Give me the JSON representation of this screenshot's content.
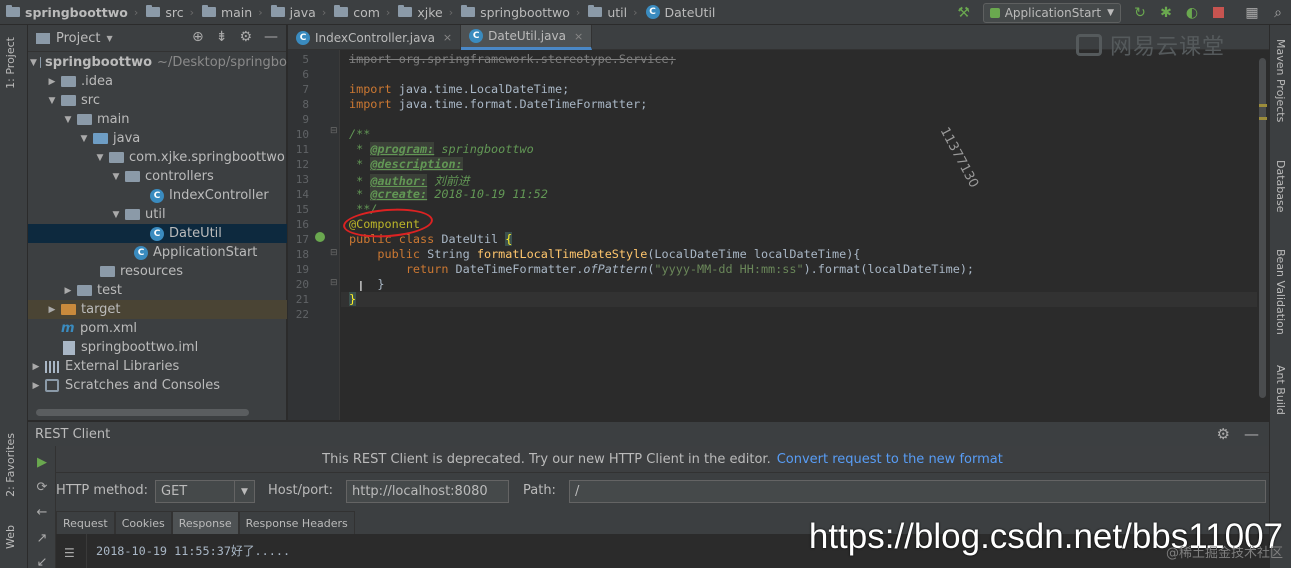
{
  "breadcrumb": [
    {
      "label": "springboottwo",
      "icon": "project-folder-icon"
    },
    {
      "label": "src",
      "icon": "folder-icon"
    },
    {
      "label": "main",
      "icon": "folder-icon"
    },
    {
      "label": "java",
      "icon": "folder-icon"
    },
    {
      "label": "com",
      "icon": "folder-icon"
    },
    {
      "label": "xjke",
      "icon": "folder-icon"
    },
    {
      "label": "springboottwo",
      "icon": "folder-icon"
    },
    {
      "label": "util",
      "icon": "folder-icon"
    },
    {
      "label": "DateUtil",
      "icon": "class-icon"
    }
  ],
  "toolbar": {
    "run_config": "ApplicationStart"
  },
  "left_stripe": {
    "project_tab": "1: Project",
    "favorites_tab": "2: Favorites",
    "web_tab": "Web"
  },
  "right_stripe": {
    "maven_tab": "Maven Projects",
    "database_tab": "Database",
    "bean_tab": "Bean Validation",
    "ant_tab": "Ant Build"
  },
  "project_panel": {
    "title": "Project",
    "root_label": "springboottwo",
    "root_path": "~/Desktop/springbo",
    "items": [
      {
        "label": ".idea"
      },
      {
        "label": "src"
      },
      {
        "label": "main"
      },
      {
        "label": "java"
      },
      {
        "label": "com.xjke.springboottwo"
      },
      {
        "label": "controllers"
      },
      {
        "label": "IndexController"
      },
      {
        "label": "util"
      },
      {
        "label": "DateUtil"
      },
      {
        "label": "ApplicationStart"
      },
      {
        "label": "resources"
      },
      {
        "label": "test"
      },
      {
        "label": "target"
      },
      {
        "label": "pom.xml"
      },
      {
        "label": "springboottwo.iml"
      },
      {
        "label": "External Libraries"
      },
      {
        "label": "Scratches and Consoles"
      }
    ]
  },
  "editor": {
    "tabs": [
      {
        "label": "IndexController.java",
        "active": false
      },
      {
        "label": "DateUtil.java",
        "active": true
      }
    ],
    "line_numbers": [
      "5",
      "6",
      "7",
      "8",
      "9",
      "10",
      "11",
      "12",
      "13",
      "14",
      "15",
      "16",
      "17",
      "18",
      "19",
      "20",
      "21",
      "22"
    ],
    "code": {
      "l5": "import org.springframework.stereotype.Service;",
      "l7_kw": "import",
      "l7_rest": " java.time.LocalDateTime;",
      "l8_kw": "import",
      "l8_rest": " java.time.format.DateTimeFormatter;",
      "l10": "/**",
      "l11_star": " * ",
      "l11_tag": "@program:",
      "l11_val": " springboottwo",
      "l12_star": " * ",
      "l12_tag": "@description:",
      "l13_star": " * ",
      "l13_tag": "@author:",
      "l13_val": " 刘前进",
      "l14_star": " * ",
      "l14_tag": "@create:",
      "l14_val": " 2018-10-19 11:52",
      "l15": " **/",
      "l16": "@Component",
      "l17_kw": "public class",
      "l17_name": " DateUtil ",
      "l17_brace": "{",
      "l18_kw": "    public",
      "l18_type": " String ",
      "l18_method": "formatLocalTimeDateStyle",
      "l18_rest": "(LocalDateTime localDateTime){",
      "l19_kw": "        return",
      "l19_cls": " DateTimeFormatter.",
      "l19_method": "ofPattern",
      "l19_paren": "(",
      "l19_str": "\"yyyy-MM-dd HH:mm:ss\"",
      "l19_rest": ").format(localDateTime);",
      "l20": "    }",
      "l21": "}"
    },
    "watermark_id": "11377130",
    "brand_watermark": "网易云课堂"
  },
  "rest_client": {
    "title": "REST Client",
    "deprecated_msg": "This REST Client is deprecated. Try our new HTTP Client in the editor.",
    "convert_link": "Convert request to the new format",
    "method_label": "HTTP method:",
    "method_value": "GET",
    "host_label": "Host/port:",
    "host_value": "http://localhost:8080",
    "path_label": "Path:",
    "path_value": "/",
    "subtabs": [
      "Request",
      "Cookies",
      "Response",
      "Response Headers"
    ],
    "active_subtab": "Response",
    "response_text": "2018-10-19 11:55:37好了....."
  },
  "overlay": {
    "csdn_url": "https://blog.csdn.net/bbs11007",
    "juejin_mark": "@稀土掘金技术社区"
  },
  "colors": {
    "bg_editor": "#2b2b2b",
    "bg_panel": "#3c3f41",
    "keyword": "#cc7832",
    "comment": "#629755",
    "annotation": "#bbb529",
    "method": "#ffc66d",
    "string": "#6a8759",
    "link": "#589df6",
    "selection": "#0d293e",
    "circle_marker": "#dd2222"
  }
}
